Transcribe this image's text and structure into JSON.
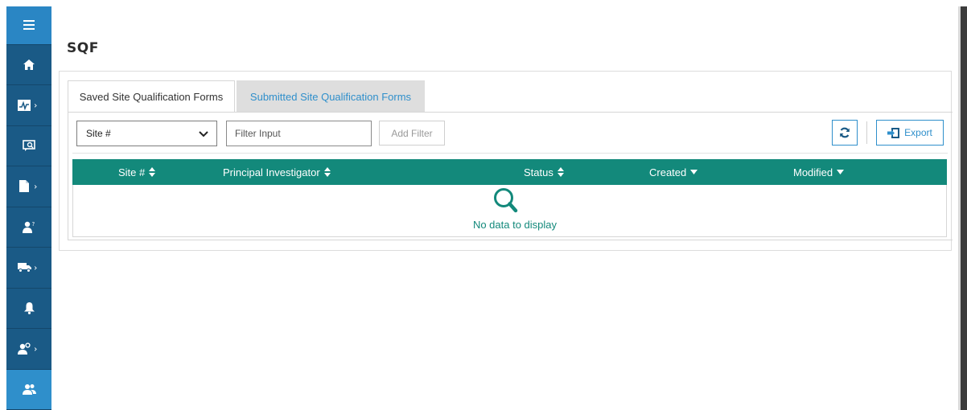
{
  "page": {
    "title": "SQF"
  },
  "tabs": [
    {
      "label": "Saved Site Qualification Forms",
      "active": true
    },
    {
      "label": "Submitted Site Qualification Forms",
      "active": false
    }
  ],
  "filters": {
    "field_select": {
      "selected": "Site #"
    },
    "input": {
      "placeholder": "Filter Input",
      "value": ""
    },
    "add_filter_label": "Add Filter"
  },
  "toolbar": {
    "export_label": "Export"
  },
  "table": {
    "columns": [
      {
        "label": "Site #",
        "sort": "both"
      },
      {
        "label": "Principal Investigator",
        "sort": "both"
      },
      {
        "label": "Status",
        "sort": "both"
      },
      {
        "label": "Created",
        "sort": "down"
      },
      {
        "label": "Modified",
        "sort": "down"
      }
    ],
    "empty_message": "No data to display"
  },
  "sidebar": {
    "items": [
      {
        "icon": "menu-icon"
      },
      {
        "icon": "home-icon"
      },
      {
        "icon": "chart-icon",
        "submenu": true
      },
      {
        "icon": "chat-search-icon"
      },
      {
        "icon": "document-icon",
        "submenu": true
      },
      {
        "icon": "user-question-icon"
      },
      {
        "icon": "truck-icon",
        "submenu": true
      },
      {
        "icon": "bell-icon"
      },
      {
        "icon": "user-settings-icon",
        "submenu": true
      },
      {
        "icon": "users-icon",
        "active": true
      }
    ]
  },
  "colors": {
    "sidebar": "#1a5a86",
    "accent": "#2f8fcb",
    "table_header": "#13897b"
  }
}
